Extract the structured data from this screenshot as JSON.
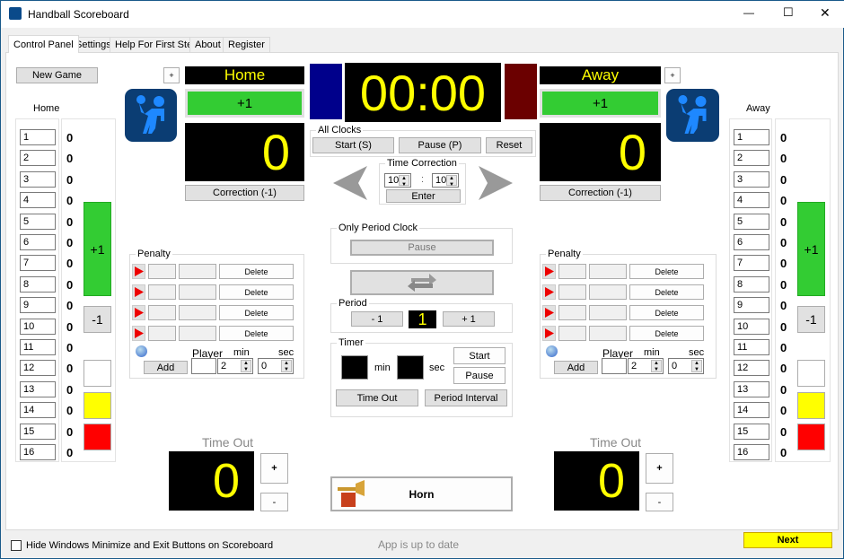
{
  "window": {
    "title": "Handball Scoreboard",
    "minimize": "—",
    "maximize": "☐",
    "close": "✕"
  },
  "tabs": [
    "Control Panel",
    "Settings",
    "Help For First Step",
    "About",
    "Register"
  ],
  "new_game": "New Game",
  "home": {
    "list_label": "Home",
    "name": "Home",
    "plus_one": "+1",
    "score": "0",
    "correction": "Correction (-1)",
    "add_team_btn": "+",
    "color": "#00008b",
    "players": [
      "1",
      "2",
      "3",
      "4",
      "5",
      "6",
      "7",
      "8",
      "9",
      "10",
      "11",
      "12",
      "13",
      "14",
      "15",
      "16"
    ],
    "goals": [
      "0",
      "0",
      "0",
      "0",
      "0",
      "0",
      "0",
      "0",
      "0",
      "0",
      "0",
      "0",
      "0",
      "0",
      "0",
      "0"
    ],
    "side_plus": "+1",
    "side_minus": "-1",
    "timeout_label": "Time Out",
    "timeouts": "0",
    "timeout_plus": "+",
    "timeout_minus": "-"
  },
  "away": {
    "list_label": "Away",
    "name": "Away",
    "plus_one": "+1",
    "score": "0",
    "correction": "Correction (-1)",
    "add_team_btn": "+",
    "color": "#6b0000",
    "players": [
      "1",
      "2",
      "3",
      "4",
      "5",
      "6",
      "7",
      "8",
      "9",
      "10",
      "11",
      "12",
      "13",
      "14",
      "15",
      "16"
    ],
    "goals": [
      "0",
      "0",
      "0",
      "0",
      "0",
      "0",
      "0",
      "0",
      "0",
      "0",
      "0",
      "0",
      "0",
      "0",
      "0",
      "0"
    ],
    "side_plus": "+1",
    "side_minus": "-1",
    "timeout_label": "Time Out",
    "timeouts": "0",
    "timeout_plus": "+",
    "timeout_minus": "-"
  },
  "clock": {
    "time": "00:00"
  },
  "all_clocks": {
    "label": "All Clocks",
    "start": "Start (S)",
    "pause": "Pause (P)",
    "reset": "Reset"
  },
  "time_correction": {
    "label": "Time Correction",
    "min": "10",
    "sep": ":",
    "sec": "10",
    "enter": "Enter"
  },
  "period_clock": {
    "label": "Only Period Clock",
    "pause": "Pause"
  },
  "period": {
    "label": "Period",
    "minus": "- 1",
    "value": "1",
    "plus": "+ 1"
  },
  "timer": {
    "label": "Timer",
    "min_label": "min",
    "sec_label": "sec",
    "start": "Start",
    "pause": "Pause",
    "time_out": "Time Out",
    "period_interval": "Period Interval"
  },
  "penalty": {
    "label": "Penalty",
    "delete": "Delete",
    "player_label": "Player",
    "min_label": "min",
    "sec_label": "sec",
    "add": "Add",
    "min_value": "2",
    "sec_value": "0"
  },
  "horn": "Horn",
  "footer": {
    "checkbox_label": "Hide Windows Minimize and Exit Buttons on Scoreboard",
    "checked": false,
    "status": "App is up to date",
    "next": "Next"
  }
}
